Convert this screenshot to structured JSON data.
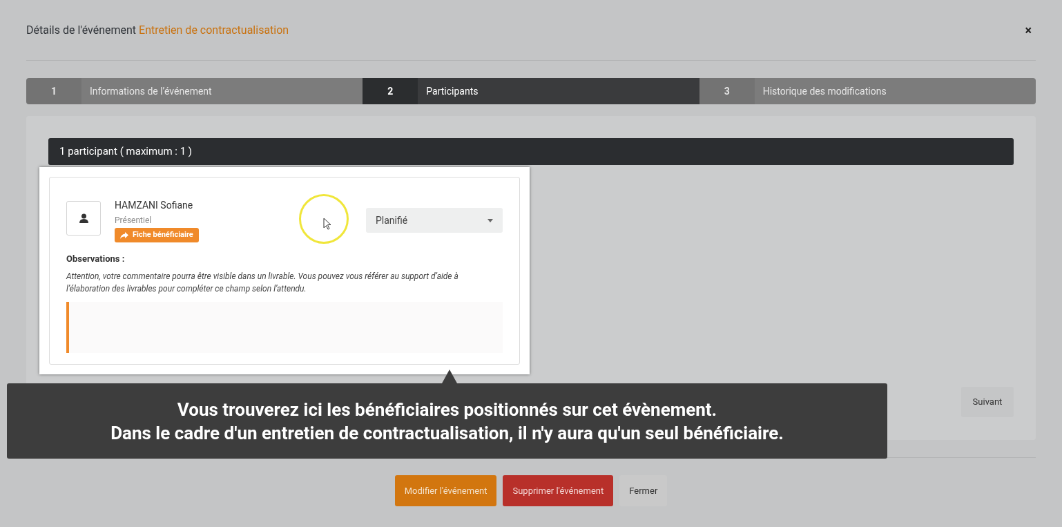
{
  "dialog": {
    "title": "Détails de l'événement",
    "event_name": "Entretien de contractualisation",
    "close": "×"
  },
  "steps": [
    {
      "number": "1",
      "label": "Informations de l’événement",
      "selected": false
    },
    {
      "number": "2",
      "label": "Participants",
      "selected": true
    },
    {
      "number": "3",
      "label": "Historique des modifications",
      "selected": false
    }
  ],
  "participants_header": "1 participant ( maximum : 1 )",
  "participant": {
    "name": "HAMZANI Sofiane",
    "mode": "Présentiel",
    "profile_button": "Fiche bénéficiaire",
    "status": "Planifié",
    "observations_label": "Observations :",
    "observations_hint": "Attention, votre commentaire pourra être visible dans un livrable. Vous pouvez vous référer au support d’aide à l’élaboration des livrables pour compléter ce champ selon l’attendu."
  },
  "next_button": "Suivant",
  "tooltip": {
    "lines": [
      "Vous trouverez ici les bénéficiaires positionnés sur cet évènement.",
      "Dans le cadre d'un entretien de contractualisation, il n'y aura qu'un seul bénéficiaire."
    ]
  },
  "footer_buttons": [
    {
      "label": "Modifier l'événement",
      "kind": "primary"
    },
    {
      "label": "Supprimer l'événement",
      "kind": "danger"
    },
    {
      "label": "Fermer",
      "kind": "default"
    }
  ]
}
